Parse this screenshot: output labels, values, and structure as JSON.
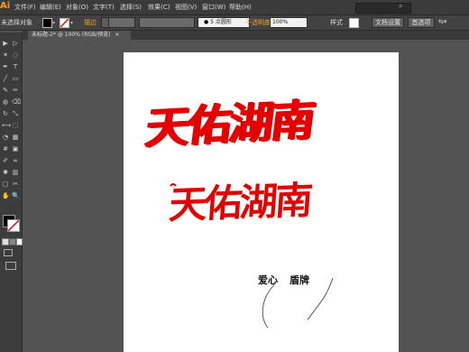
{
  "app": {
    "logo": "Ai",
    "menu": [
      "文件(F)",
      "编辑(E)",
      "对象(O)",
      "文字(T)",
      "选择(S)",
      "效果(C)",
      "视图(V)",
      "窗口(W)",
      "帮助(H)"
    ]
  },
  "control_bar": {
    "selection_status": "未选择对象",
    "stroke_label": "描边",
    "brush_value": "5 点圆形",
    "opacity_label": "不透明度",
    "opacity_value": "100%",
    "style_label": "样式",
    "doc_setup_button": "文档设置",
    "prefs_button": "首选项",
    "fill_color": "#000000",
    "stroke_color": "#ff0000"
  },
  "document_tab": {
    "label": "未标题-2* @ 100% (RGB/预览)",
    "close": "×"
  },
  "toolbox": {
    "icons": [
      "selection-tool-icon",
      "direct-selection-tool-icon",
      "magic-wand-icon",
      "lasso-icon",
      "pen-icon",
      "type-icon",
      "line-icon",
      "rectangle-icon",
      "paintbrush-icon",
      "pencil-icon",
      "blob-brush-icon",
      "eraser-icon",
      "rotate-icon",
      "scale-icon",
      "width-icon",
      "free-transform-icon",
      "shape-builder-icon",
      "perspective-icon",
      "mesh-icon",
      "gradient-icon",
      "eyedropper-icon",
      "blend-icon",
      "symbol-sprayer-icon",
      "graph-icon",
      "artboard-icon",
      "slice-icon",
      "hand-icon",
      "zoom-icon"
    ],
    "glyphs": [
      "▶",
      "▷",
      "✶",
      "◌",
      "✒",
      "T",
      "╱",
      "▭",
      "✎",
      "✏",
      "◍",
      "⌫",
      "↻",
      "⤡",
      "⟷",
      "⬚",
      "◔",
      "▦",
      "#",
      "▣",
      "✐",
      "∞",
      "✺",
      "▥",
      "▢",
      "✂",
      "✋",
      "🔍"
    ]
  },
  "artboard": {
    "calligraphy_top": "天佑湖南",
    "calligraphy_bottom": "天佑湖南",
    "annotation_left": "爱心",
    "annotation_right": "盾牌"
  }
}
